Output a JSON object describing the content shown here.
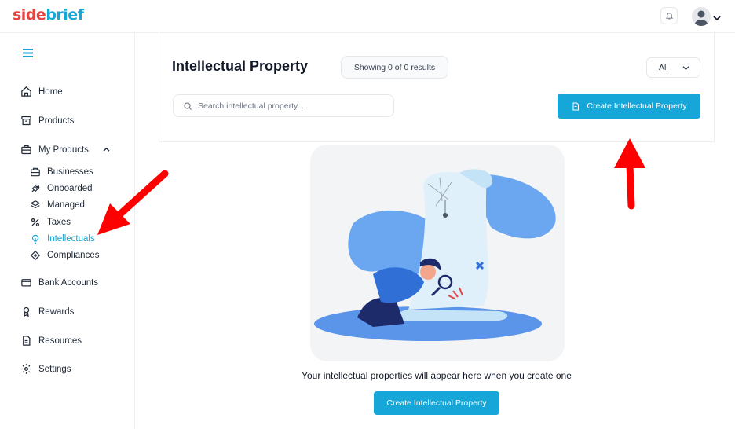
{
  "brand": {
    "logo_part1": "side",
    "logo_part2": "brief"
  },
  "header": {
    "bell_icon": "bell-icon",
    "avatar_icon": "user-avatar-icon"
  },
  "sidebar": {
    "menu_icon": "hamburger-icon",
    "items": [
      {
        "label": "Home",
        "icon": "home-icon"
      },
      {
        "label": "Products",
        "icon": "archive-icon"
      },
      {
        "label": "My Products",
        "icon": "briefcase-icon"
      }
    ],
    "sub_items": [
      {
        "label": "Businesses",
        "icon": "briefcase-icon"
      },
      {
        "label": "Onboarded",
        "icon": "rocket-icon"
      },
      {
        "label": "Managed",
        "icon": "layers-icon"
      },
      {
        "label": "Taxes",
        "icon": "percent-icon"
      },
      {
        "label": "Intellectuals",
        "icon": "lightbulb-icon"
      },
      {
        "label": "Compliances",
        "icon": "diamond-icon"
      }
    ],
    "bottom_items": [
      {
        "label": "Bank Accounts",
        "icon": "card-icon"
      },
      {
        "label": "Rewards",
        "icon": "medal-icon"
      },
      {
        "label": "Resources",
        "icon": "document-icon"
      },
      {
        "label": "Settings",
        "icon": "gear-icon"
      }
    ],
    "active": "Intellectuals"
  },
  "main": {
    "title": "Intellectual Property",
    "results": "Showing 0 of 0 results",
    "filter_value": "All",
    "search_placeholder": "Search intellectual property...",
    "create_button": "Create Intellectual Property",
    "empty_message": "Your intellectual properties will appear here when you create one",
    "create_button_bottom": "Create Intellectual Property"
  },
  "colors": {
    "accent": "#16a6d8",
    "logo_red": "#e8423f",
    "annotation_red": "#ff0000"
  }
}
